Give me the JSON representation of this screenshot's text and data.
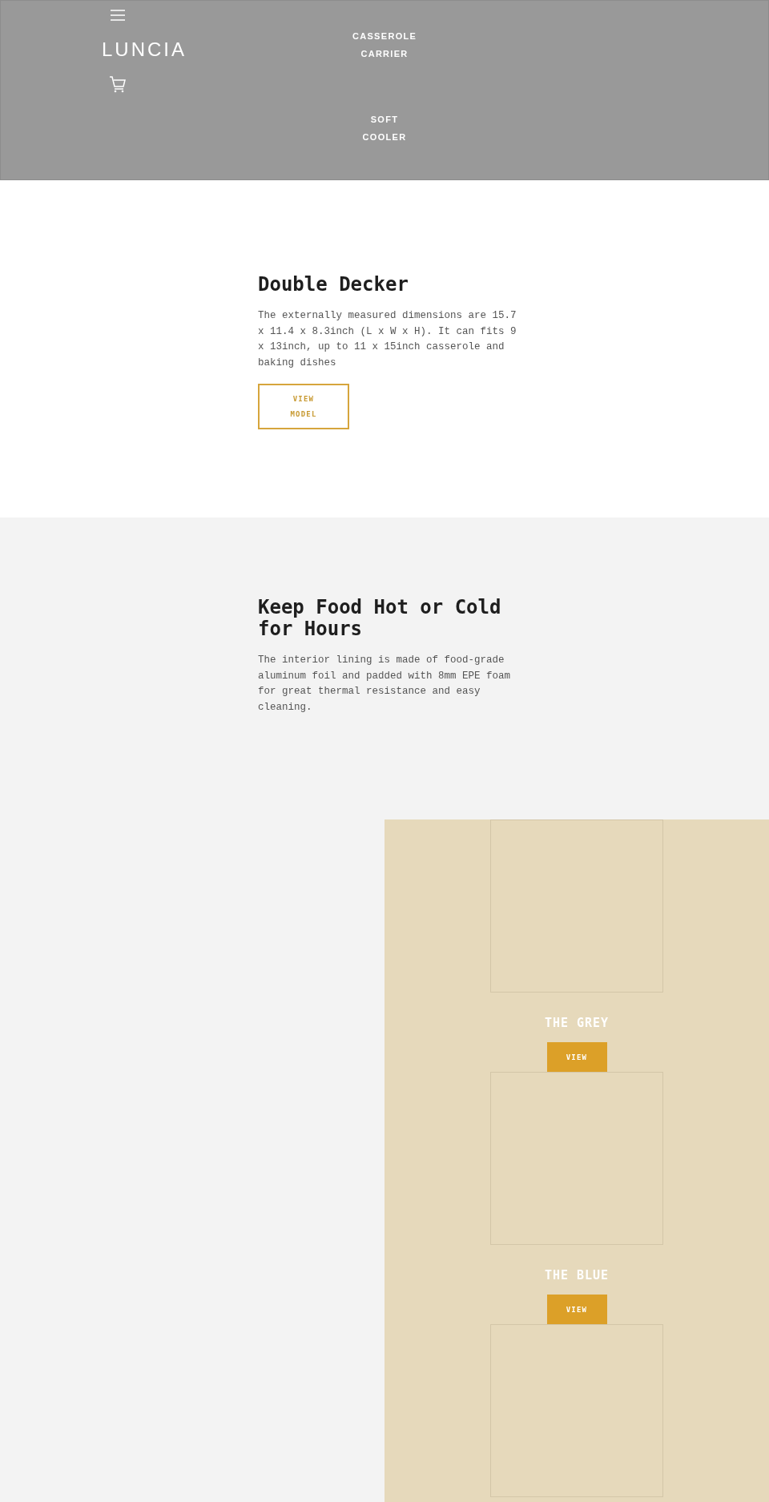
{
  "header": {
    "logo": "LUNCIA",
    "nav": [
      {
        "label": "CASSEROLE CARRIER"
      },
      {
        "label": "SOFT COOLER"
      }
    ]
  },
  "sections": [
    {
      "heading": "Double Decker",
      "body": "The externally measured dimensions are 15.7 x 11.4 x 8.3inch (L x W x H). It can fits 9 x 13inch, up to 11 x 15inch casserole and baking dishes",
      "button": "VIEW MODEL"
    },
    {
      "heading": "Keep Food Hot or Cold for Hours",
      "body": "The interior lining is made of food-grade aluminum foil and padded with 8mm EPE foam for great thermal resistance and easy cleaning."
    }
  ],
  "products": [
    {
      "kind": "card",
      "title": "THE GREY",
      "button": "VIEW"
    },
    {
      "kind": "card",
      "title": "THE BLUE",
      "button": "VIEW"
    },
    {
      "kind": "image-only"
    }
  ]
}
